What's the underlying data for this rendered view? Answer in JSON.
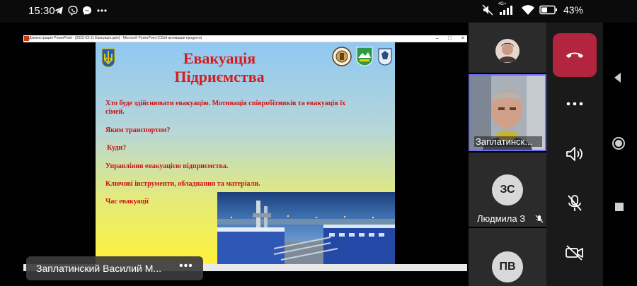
{
  "status_bar": {
    "time": "15:30",
    "left_icons": [
      "telegram-icon",
      "viber-icon",
      "messenger-icon",
      "more-dots-icon"
    ],
    "right_icons": [
      "mute-icon",
      "signal-4g-icon",
      "wifi-icon",
      "battery-icon"
    ],
    "network_label": "4G+",
    "battery": "43%"
  },
  "ppt_window": {
    "title": "Демонстрация PowerPoint - [2022-03-11 Евакуація.pptx] - Microsoft PowerPoint (Сбой активации продукта)",
    "buttons": [
      "–",
      "□",
      "×"
    ]
  },
  "slide": {
    "title_line1": "Евакуація",
    "title_line2": "Підриємства",
    "lines": [
      "Хто буде здійснювати евакуацію. Мотивація співробітників та евакуація їх",
      "сімей.",
      "Яким транспортом?",
      "Куди?",
      "Управління евакуацією підприємства.",
      "Ключові  інструменти, обладнання  та матеріали.",
      "Час евакуації"
    ],
    "accent_color": "#cf1111"
  },
  "presenter": {
    "name": "Заплатинский Василий М...",
    "more": "•••"
  },
  "participants": [
    {
      "type": "avatar-photo"
    },
    {
      "type": "video",
      "name": "Заплатинск..."
    },
    {
      "type": "initials",
      "initials": "ЗС",
      "name": "Людмила З"
    },
    {
      "type": "initials",
      "initials": "ПВ"
    }
  ],
  "controls": [
    "end-call",
    "more",
    "speaker",
    "mic-off",
    "camera-off"
  ],
  "colors": {
    "end_call": "#b3243f",
    "active_border": "#6b6bf0"
  }
}
